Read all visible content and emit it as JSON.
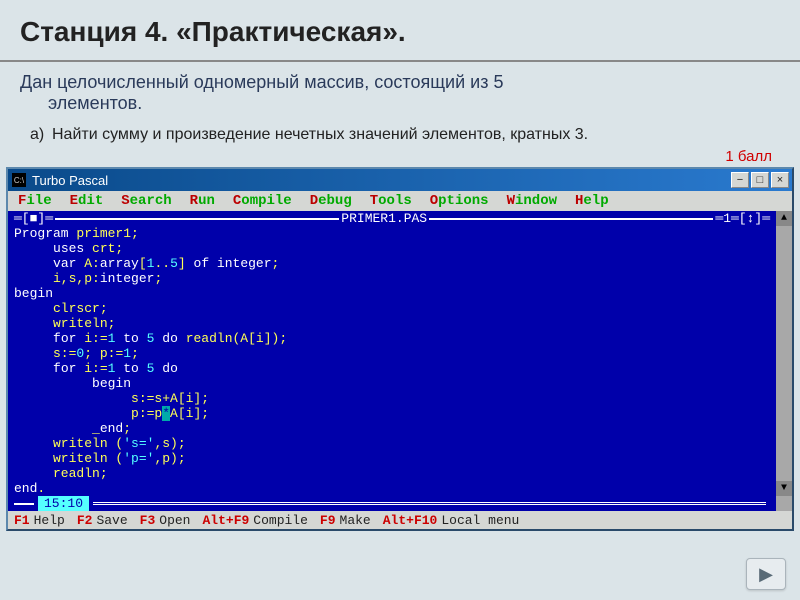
{
  "slide": {
    "title": "Станция 4. «Практическая».",
    "task_line1": "Дан целочисленный одномерный массив, состоящий из 5",
    "task_line1b": "элементов.",
    "subtask_marker": "а)",
    "subtask_text": "Найти сумму и произведение нечетных значений элементов, кратных 3.",
    "score": "1 балл"
  },
  "window": {
    "app_title": "Turbo Pascal",
    "logo_glyph": "C:\\",
    "buttons": {
      "minimize": "−",
      "maximize": "□",
      "close": "×"
    }
  },
  "menu": [
    {
      "hot": "F",
      "rest": "ile"
    },
    {
      "hot": "E",
      "rest": "dit"
    },
    {
      "hot": "S",
      "rest": "earch"
    },
    {
      "hot": "R",
      "rest": "un"
    },
    {
      "hot": "C",
      "rest": "ompile"
    },
    {
      "hot": "D",
      "rest": "ebug"
    },
    {
      "hot": "T",
      "rest": "ools"
    },
    {
      "hot": "O",
      "rest": "ptions"
    },
    {
      "hot": "W",
      "rest": "indow"
    },
    {
      "hot": "H",
      "rest": "elp"
    }
  ],
  "editor": {
    "frame_left": "═[■]═",
    "frame_file": " PRIMER1.PAS ",
    "frame_right": "═1═[↕]═",
    "cursor_pos": "15:10",
    "lines": [
      [
        {
          "c": "kw",
          "t": "Program "
        },
        {
          "c": "id",
          "t": "primer1;"
        }
      ],
      [
        {
          "c": "id",
          "t": "     "
        },
        {
          "c": "kw",
          "t": "uses "
        },
        {
          "c": "id",
          "t": "crt;"
        }
      ],
      [
        {
          "c": "id",
          "t": "     "
        },
        {
          "c": "kw",
          "t": "var "
        },
        {
          "c": "id",
          "t": "A:"
        },
        {
          "c": "kw",
          "t": "array"
        },
        {
          "c": "id",
          "t": "["
        },
        {
          "c": "num",
          "t": "1"
        },
        {
          "c": "id",
          "t": ".."
        },
        {
          "c": "num",
          "t": "5"
        },
        {
          "c": "id",
          "t": "] "
        },
        {
          "c": "kw",
          "t": "of integer"
        },
        {
          "c": "id",
          "t": ";"
        }
      ],
      [
        {
          "c": "id",
          "t": "     i,s,p:"
        },
        {
          "c": "kw",
          "t": "integer"
        },
        {
          "c": "id",
          "t": ";"
        }
      ],
      [
        {
          "c": "kw",
          "t": "begin"
        }
      ],
      [
        {
          "c": "id",
          "t": "     clrscr;"
        }
      ],
      [
        {
          "c": "id",
          "t": "     writeln;"
        }
      ],
      [
        {
          "c": "id",
          "t": "     "
        },
        {
          "c": "kw",
          "t": "for "
        },
        {
          "c": "id",
          "t": "i:="
        },
        {
          "c": "num",
          "t": "1"
        },
        {
          "c": "kw",
          "t": " to "
        },
        {
          "c": "num",
          "t": "5"
        },
        {
          "c": "kw",
          "t": " do "
        },
        {
          "c": "id",
          "t": "readln(A[i]);"
        }
      ],
      [
        {
          "c": "id",
          "t": "     s:="
        },
        {
          "c": "num",
          "t": "0"
        },
        {
          "c": "id",
          "t": "; p:="
        },
        {
          "c": "num",
          "t": "1"
        },
        {
          "c": "id",
          "t": ";"
        }
      ],
      [
        {
          "c": "id",
          "t": "     "
        },
        {
          "c": "kw",
          "t": "for "
        },
        {
          "c": "id",
          "t": "i:="
        },
        {
          "c": "num",
          "t": "1"
        },
        {
          "c": "kw",
          "t": " to "
        },
        {
          "c": "num",
          "t": "5"
        },
        {
          "c": "kw",
          "t": " do"
        }
      ],
      [
        {
          "c": "id",
          "t": ""
        }
      ],
      [
        {
          "c": "id",
          "t": "          "
        },
        {
          "c": "kw",
          "t": "begin"
        }
      ],
      [
        {
          "c": "id",
          "t": "               s:=s+A[i];"
        }
      ],
      [
        {
          "c": "id",
          "t": "               p:=p"
        },
        {
          "c": "hl",
          "t": "*"
        },
        {
          "c": "id",
          "t": "A[i];"
        }
      ],
      [
        {
          "c": "id",
          "t": "          _"
        },
        {
          "c": "kw",
          "t": "end"
        },
        {
          "c": "id",
          "t": ";"
        }
      ],
      [
        {
          "c": "id",
          "t": "     writeln ("
        },
        {
          "c": "str",
          "t": "'s='"
        },
        {
          "c": "id",
          "t": ",s);"
        }
      ],
      [
        {
          "c": "id",
          "t": "     writeln ("
        },
        {
          "c": "str",
          "t": "'p='"
        },
        {
          "c": "id",
          "t": ",p);"
        }
      ],
      [
        {
          "c": "id",
          "t": "     readln;"
        }
      ],
      [
        {
          "c": "kw",
          "t": "end"
        },
        {
          "c": "id",
          "t": "."
        }
      ]
    ]
  },
  "hints": [
    {
      "key": "F1",
      "text": "Help"
    },
    {
      "key": "F2",
      "text": "Save"
    },
    {
      "key": "F3",
      "text": "Open"
    },
    {
      "key": "Alt+F9",
      "text": "Compile"
    },
    {
      "key": "F9",
      "text": "Make"
    },
    {
      "key": "Alt+F10",
      "text": "Local menu"
    }
  ],
  "nav_glyph": "▶"
}
